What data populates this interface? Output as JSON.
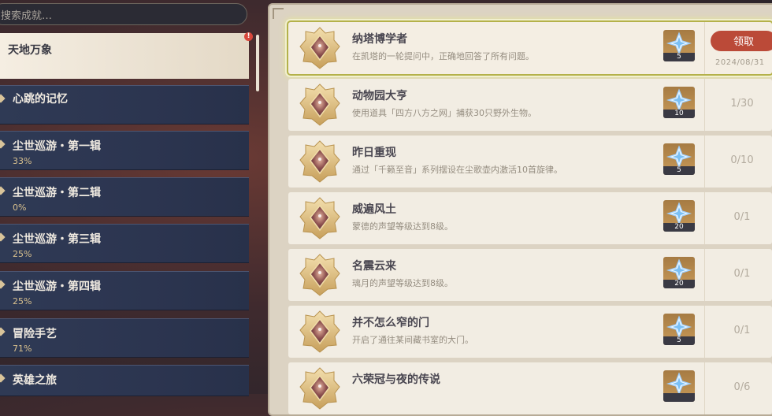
{
  "search": {
    "placeholder": "搜索成就…"
  },
  "categories": [
    {
      "name": "天地万象",
      "pct": "",
      "active": true,
      "alert": "!"
    },
    {
      "name": "心跳的记忆",
      "pct": ""
    },
    {
      "name": "尘世巡游・第一辑",
      "pct": "33%"
    },
    {
      "name": "尘世巡游・第二辑",
      "pct": "0%"
    },
    {
      "name": "尘世巡游・第三辑",
      "pct": "25%"
    },
    {
      "name": "尘世巡游・第四辑",
      "pct": "25%"
    },
    {
      "name": "冒险手艺",
      "pct": "71%"
    },
    {
      "name": "英雄之旅",
      "pct": ""
    }
  ],
  "achievements": [
    {
      "title": "纳塔博学者",
      "desc": "在凯塔的一轮提问中，正确地回答了所有问题。",
      "reward": "5",
      "button": "领取",
      "date": "2024/08/31"
    },
    {
      "title": "动物园大亨",
      "desc": "使用道具「四方八方之网」捕获30只野外生物。",
      "reward": "10",
      "progress": "1/30"
    },
    {
      "title": "昨日重现",
      "desc": "通过「千籁至音」系列摆设在尘歌壶内激活10首旋律。",
      "reward": "5",
      "progress": "0/10"
    },
    {
      "title": "威遍风土",
      "desc": "蒙德的声望等级达到8级。",
      "reward": "20",
      "progress": "0/1"
    },
    {
      "title": "名震云来",
      "desc": "璃月的声望等级达到8级。",
      "reward": "20",
      "progress": "0/1"
    },
    {
      "title": "并不怎么窄的门",
      "desc": "开启了通往某间藏书室的大门。",
      "reward": "5",
      "progress": "0/1"
    },
    {
      "title": "六荣冠与夜的传说",
      "desc": "",
      "reward": "",
      "progress": "0/6"
    }
  ],
  "colors": {
    "claim": "#bb4a38",
    "highlight": "#b4b14a",
    "category_bg": "#2f3a55"
  }
}
